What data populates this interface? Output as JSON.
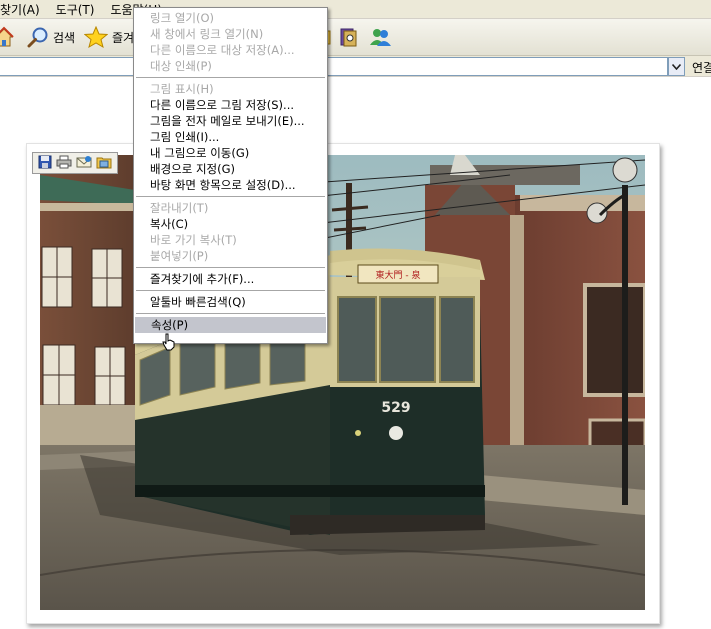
{
  "menubar": {
    "items": [
      "찾기(A)",
      "도구(T)",
      "도움말(H)"
    ]
  },
  "toolbar": {
    "search_label": "검색",
    "favorites_label": "즐겨"
  },
  "addressbar": {
    "go_label": "연결"
  },
  "image_toolbar": {
    "icons": [
      "save-icon",
      "print-icon",
      "email-icon",
      "my-pictures-icon"
    ]
  },
  "context_menu": {
    "items": [
      {
        "label": "링크 열기(O)",
        "disabled": true
      },
      {
        "label": "새 창에서 링크 열기(N)",
        "disabled": true
      },
      {
        "label": "다른 이름으로 대상 저장(A)...",
        "disabled": true
      },
      {
        "label": "대상 인쇄(P)",
        "disabled": true
      },
      {
        "separator": true
      },
      {
        "label": "그림 표시(H)",
        "disabled": true
      },
      {
        "label": "다른 이름으로 그림 저장(S)...",
        "disabled": false
      },
      {
        "label": "그림을 전자 메일로 보내기(E)...",
        "disabled": false
      },
      {
        "label": "그림 인쇄(I)...",
        "disabled": false
      },
      {
        "label": "내 그림으로 이동(G)",
        "disabled": false
      },
      {
        "label": "배경으로 지정(G)",
        "disabled": false
      },
      {
        "label": "바탕 화면 항목으로 설정(D)...",
        "disabled": false
      },
      {
        "separator": true
      },
      {
        "label": "잘라내기(T)",
        "disabled": true
      },
      {
        "label": "복사(C)",
        "disabled": false
      },
      {
        "label": "바로 가기 복사(T)",
        "disabled": true
      },
      {
        "label": "붙여넣기(P)",
        "disabled": true
      },
      {
        "separator": true
      },
      {
        "label": "즐겨찾기에 추가(F)...",
        "disabled": false
      },
      {
        "separator": true
      },
      {
        "label": "알툴바 빠른검색(Q)",
        "disabled": false
      },
      {
        "separator": true
      },
      {
        "label": "속성(P)",
        "disabled": false,
        "selected": true
      }
    ]
  },
  "photo": {
    "tram_number": "529",
    "tram_sign": "東大門 - 泉"
  },
  "colors": {
    "menu_bg": "#ece9d8",
    "menu_highlight": "#c3c5cd",
    "disabled_text": "#a8a8a8",
    "tram_body": "#1e2e28",
    "tram_top": "#d9cf9a"
  }
}
